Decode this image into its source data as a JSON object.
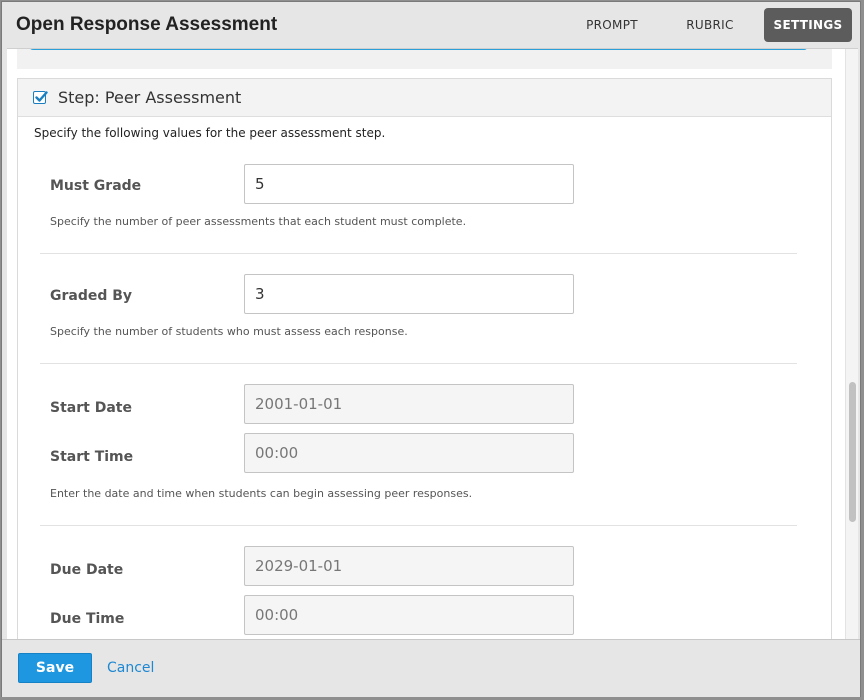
{
  "header": {
    "title": "Open Response Assessment",
    "tabs": [
      {
        "label": "PROMPT",
        "active": false
      },
      {
        "label": "RUBRIC",
        "active": false
      },
      {
        "label": "SETTINGS",
        "active": true
      }
    ]
  },
  "section": {
    "title": "Step: Peer Assessment",
    "checked": true,
    "description": "Specify the following values for the peer assessment step.",
    "must_grade": {
      "label": "Must Grade",
      "value": "5",
      "help": "Specify the number of peer assessments that each student must complete."
    },
    "graded_by": {
      "label": "Graded By",
      "value": "3",
      "help": "Specify the number of students who must assess each response."
    },
    "start": {
      "date_label": "Start Date",
      "date_value": "2001-01-01",
      "time_label": "Start Time",
      "time_value": "00:00",
      "help": "Enter the date and time when students can begin assessing peer responses."
    },
    "due": {
      "date_label": "Due Date",
      "date_value": "2029-01-01",
      "time_label": "Due Time",
      "time_value": "00:00"
    }
  },
  "footer": {
    "save_label": "Save",
    "cancel_label": "Cancel"
  },
  "colors": {
    "accent": "#1e97e0",
    "active_tab": "#5c5c5c",
    "checkbox": "#1a7fc0"
  }
}
